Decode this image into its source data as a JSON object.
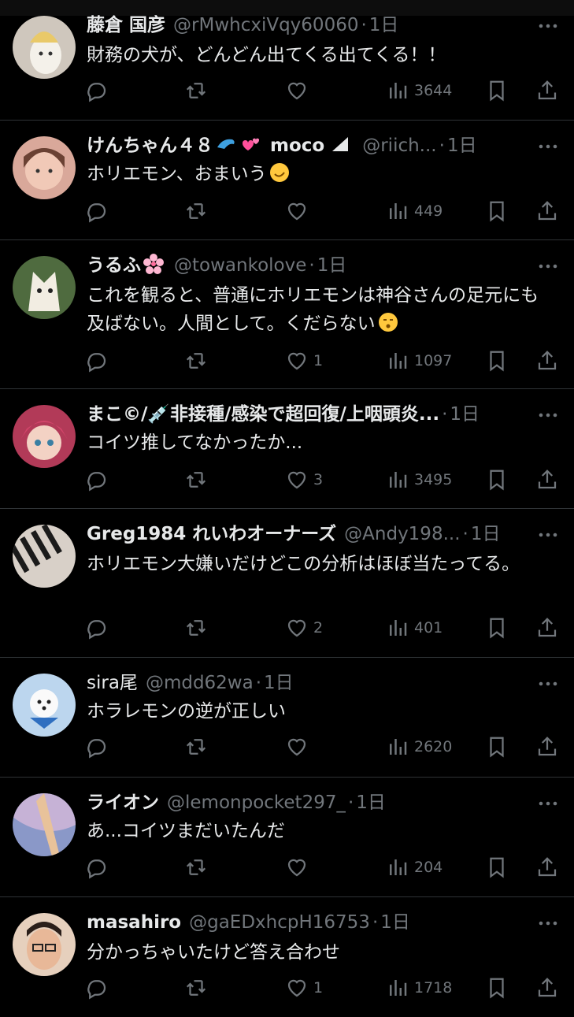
{
  "tweets": [
    {
      "name": "藤倉 国彦",
      "handle": "@rMwhcxiVqy60060",
      "time": "1日",
      "text": "財務の犬が、どんどん出てくる出てくる！！",
      "likes": "",
      "views": "3644",
      "avatar": "plush-avatar",
      "bg": "#cfc7bd"
    },
    {
      "name": "けんちゃん４８",
      "name_suffix": "moco",
      "handle": "@riich...",
      "time": "1日",
      "text": "ホリエモン、おまいう",
      "likes": "",
      "views": "449",
      "avatar": "girl-avatar",
      "bg": "#d9a89a"
    },
    {
      "name": "うるふ",
      "handle": "@towankolove",
      "time": "1日",
      "text": "これを観ると、普通にホリエモンは神谷さんの足元にも及ばない。人間として。くだらない",
      "likes": "1",
      "views": "1097",
      "avatar": "wolf-avatar",
      "bg": "#4f6b3f"
    },
    {
      "name": "まこ©/💉非接種/感染で超回復/上咽頭炎...",
      "handle": "",
      "time": "1日",
      "text": "コイツ推してなかったか...",
      "likes": "3",
      "views": "3495",
      "avatar": "anime-avatar",
      "bg": "#b23a58"
    },
    {
      "name": "Greg1984 れいわオーナーズ",
      "handle": "@Andy198...",
      "time": "1日",
      "text": "ホリエモン大嫌いだけどこの分析はほぼ当たってる。",
      "likes": "2",
      "views": "401",
      "avatar": "piano-avatar",
      "bg": "#d8d0c8"
    },
    {
      "name": "sira尾",
      "handle": "@mdd62wa",
      "time": "1日",
      "text": "ホラレモンの逆が正しい",
      "likes": "",
      "views": "2620",
      "avatar": "dog-avatar",
      "bg": "#bcd6ee"
    },
    {
      "name": "ライオン",
      "handle": "@lemonpocket297_",
      "time": "1日",
      "text": "あ...コイツまだいたんだ",
      "likes": "",
      "views": "204",
      "avatar": "sky-avatar",
      "bg": "#8a98c8"
    },
    {
      "name": "masahiro",
      "handle": "@gaEDxhcpH16753",
      "time": "1日",
      "text": "分かっちゃいたけど答え合わせ",
      "likes": "1",
      "views": "1718",
      "avatar": "face-avatar",
      "bg": "#e6d0bd"
    }
  ],
  "icons": {
    "reply": "reply-icon",
    "retweet": "retweet-icon",
    "like": "heart-icon",
    "views": "views-icon",
    "bookmark": "bookmark-icon",
    "share": "share-icon",
    "more": "more-icon"
  }
}
